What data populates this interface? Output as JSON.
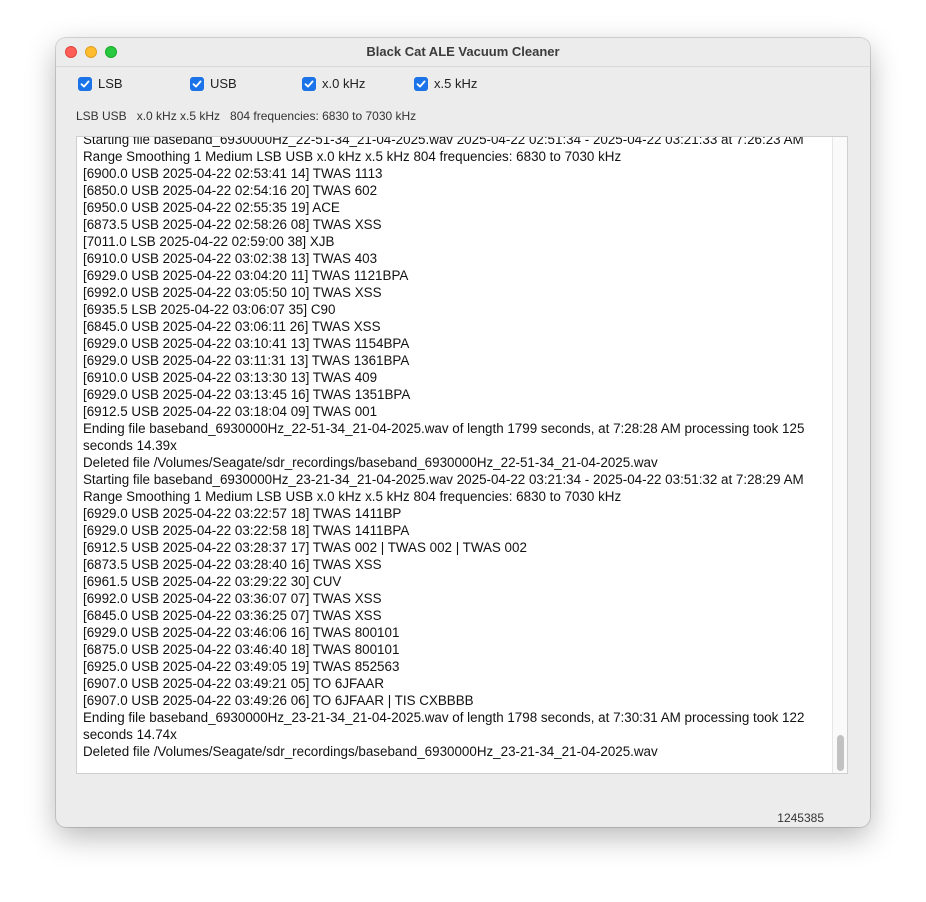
{
  "window": {
    "title": "Black Cat ALE Vacuum Cleaner"
  },
  "options": [
    {
      "label": "LSB",
      "checked": true
    },
    {
      "label": "USB",
      "checked": true
    },
    {
      "label": "x.0 kHz",
      "checked": true
    },
    {
      "label": "x.5 kHz",
      "checked": true
    }
  ],
  "summary": "LSB USB   x.0 kHz x.5 kHz   804 frequencies: 6830 to 7030 kHz",
  "log": {
    "lines": [
      "Starting file baseband_6930000Hz_22-51-34_21-04-2025.wav 2025-04-22 02:51:34 - 2025-04-22 03:21:33 at 7:26:23 AM   Range   Smoothing 1   Medium   LSB USB   x.0 kHz x.5 kHz   804 frequencies: 6830 to 7030 kHz",
      "[6900.0 USB 2025-04-22 02:53:41 14] TWAS 1113",
      "[6850.0 USB 2025-04-22 02:54:16 20] TWAS 602",
      "[6950.0 USB 2025-04-22 02:55:35 19]  ACE",
      "[6873.5 USB 2025-04-22 02:58:26 08] TWAS XSS",
      "[7011.0 LSB 2025-04-22 02:59:00 38]  XJB",
      "[6910.0 USB 2025-04-22 03:02:38 13] TWAS 403",
      "[6929.0 USB 2025-04-22 03:04:20 11] TWAS 1121BPA",
      "[6992.0 USB 2025-04-22 03:05:50 10] TWAS XSS",
      "[6935.5 LSB 2025-04-22 03:06:07 35]  C90",
      "[6845.0 USB 2025-04-22 03:06:11 26] TWAS XSS",
      "[6929.0 USB 2025-04-22 03:10:41 13] TWAS 1154BPA",
      "[6929.0 USB 2025-04-22 03:11:31 13] TWAS 1361BPA",
      "[6910.0 USB 2025-04-22 03:13:30 13] TWAS 409",
      "[6929.0 USB 2025-04-22 03:13:45 16] TWAS 1351BPA",
      "[6912.5 USB 2025-04-22 03:18:04 09] TWAS 001",
      "Ending file baseband_6930000Hz_22-51-34_21-04-2025.wav of length 1799 seconds, at 7:28:28 AM processing took 125 seconds 14.39x",
      "Deleted file /Volumes/Seagate/sdr_recordings/baseband_6930000Hz_22-51-34_21-04-2025.wav",
      "Starting file baseband_6930000Hz_23-21-34_21-04-2025.wav 2025-04-22 03:21:34 - 2025-04-22 03:51:32 at 7:28:29 AM   Range   Smoothing 1   Medium   LSB USB   x.0 kHz x.5 kHz   804 frequencies: 6830 to 7030 kHz",
      "[6929.0 USB 2025-04-22 03:22:57 18] TWAS 1411BP",
      "[6929.0 USB 2025-04-22 03:22:58 18] TWAS 1411BPA",
      "[6912.5 USB 2025-04-22 03:28:37 17] TWAS 002 | TWAS 002 | TWAS 002",
      "[6873.5 USB 2025-04-22 03:28:40 16] TWAS XSS",
      "[6961.5 USB 2025-04-22 03:29:22 30]  CUV",
      "[6992.0 USB 2025-04-22 03:36:07 07] TWAS XSS",
      "[6845.0 USB 2025-04-22 03:36:25 07] TWAS XSS",
      "[6929.0 USB 2025-04-22 03:46:06 16] TWAS 800101",
      "[6875.0 USB 2025-04-22 03:46:40 18] TWAS 800101",
      "[6925.0 USB 2025-04-22 03:49:05 19] TWAS 852563",
      "[6907.0 USB 2025-04-22 03:49:21 05] TO 6JFAAR",
      "[6907.0 USB 2025-04-22 03:49:26 06] TO 6JFAAR | TIS CXBBBB",
      "Ending file baseband_6930000Hz_23-21-34_21-04-2025.wav of length 1798 seconds, at 7:30:31 AM processing took 122 seconds 14.74x",
      "Deleted file /Volumes/Seagate/sdr_recordings/baseband_6930000Hz_23-21-34_21-04-2025.wav"
    ]
  },
  "status": {
    "counter": "1245385"
  },
  "colors": {
    "accent": "#1a73e8",
    "close": "#ff5f57",
    "minimize": "#febc2e",
    "maximize": "#28c840"
  }
}
